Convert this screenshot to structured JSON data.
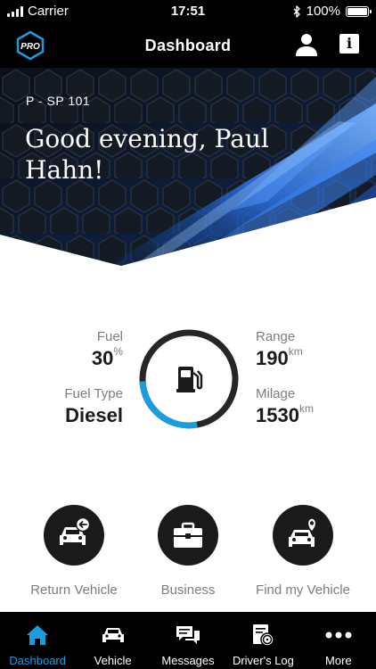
{
  "status_bar": {
    "carrier": "Carrier",
    "time": "17:51",
    "battery": "100%"
  },
  "nav_bar": {
    "logo_text": "PRO",
    "title": "Dashboard"
  },
  "hero": {
    "plate": "P - SP 101",
    "greeting": "Good evening, Paul Hahn!"
  },
  "vehicle_stats": {
    "fuel_label": "Fuel",
    "fuel_value": "30",
    "fuel_unit": "%",
    "fuel_type_label": "Fuel Type",
    "fuel_type_value": "Diesel",
    "range_label": "Range",
    "range_value": "190",
    "range_unit": "km",
    "mileage_label": "Milage",
    "mileage_value": "1530",
    "mileage_unit": "km",
    "fuel_level_fraction": 0.3,
    "gauge_fill_color": "#1a9cdf",
    "gauge_track_color": "#262626"
  },
  "actions": [
    {
      "label": "Return Vehicle",
      "icon": "return-vehicle-icon"
    },
    {
      "label": "Business",
      "icon": "briefcase-icon"
    },
    {
      "label": "Find my Vehicle",
      "icon": "find-vehicle-icon"
    }
  ],
  "tabs": [
    {
      "label": "Dashboard",
      "icon": "home-icon",
      "active": true
    },
    {
      "label": "Vehicle",
      "icon": "car-icon",
      "active": false
    },
    {
      "label": "Messages",
      "icon": "messages-icon",
      "active": false
    },
    {
      "label": "Driver's Log",
      "icon": "drivers-log-icon",
      "active": false
    },
    {
      "label": "More",
      "icon": "more-icon",
      "active": false
    }
  ],
  "colors": {
    "accent": "#1a9cdf",
    "bar_background": "#000000",
    "action_circle": "#1a1a1a",
    "muted_text": "#7d7d7d"
  }
}
